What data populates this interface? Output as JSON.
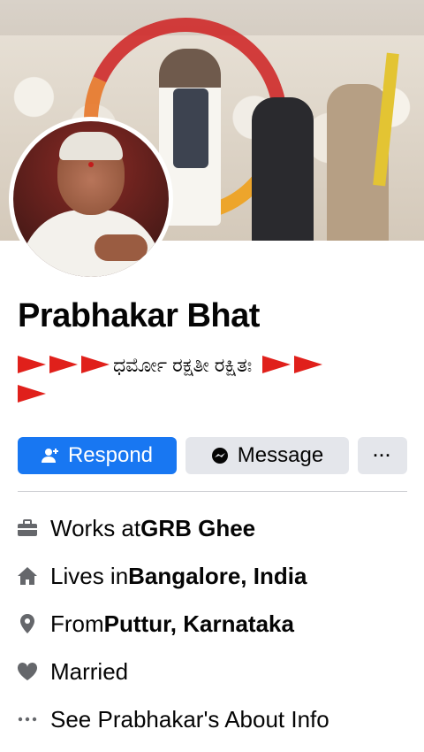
{
  "profile": {
    "name": "Prabhakar Bhat",
    "bio_text": "ಧರ್ಮೋ ರಕ್ಷತೀ ರಕ್ಷಿತಃ",
    "flag_color": "#e0201b"
  },
  "actions": {
    "respond_label": "Respond",
    "message_label": "Message",
    "more_label": "···",
    "accent_color": "#1877f2"
  },
  "details": [
    {
      "icon": "briefcase-icon",
      "prefix": "Works at ",
      "value": "GRB Ghee"
    },
    {
      "icon": "home-icon",
      "prefix": "Lives in ",
      "value": "Bangalore, India"
    },
    {
      "icon": "location-pin-icon",
      "prefix": "From ",
      "value": "Puttur, Karnataka"
    },
    {
      "icon": "heart-icon",
      "prefix": "Married",
      "value": ""
    },
    {
      "icon": "more-dots-icon",
      "prefix": "See Prabhakar's About Info",
      "value": ""
    }
  ]
}
